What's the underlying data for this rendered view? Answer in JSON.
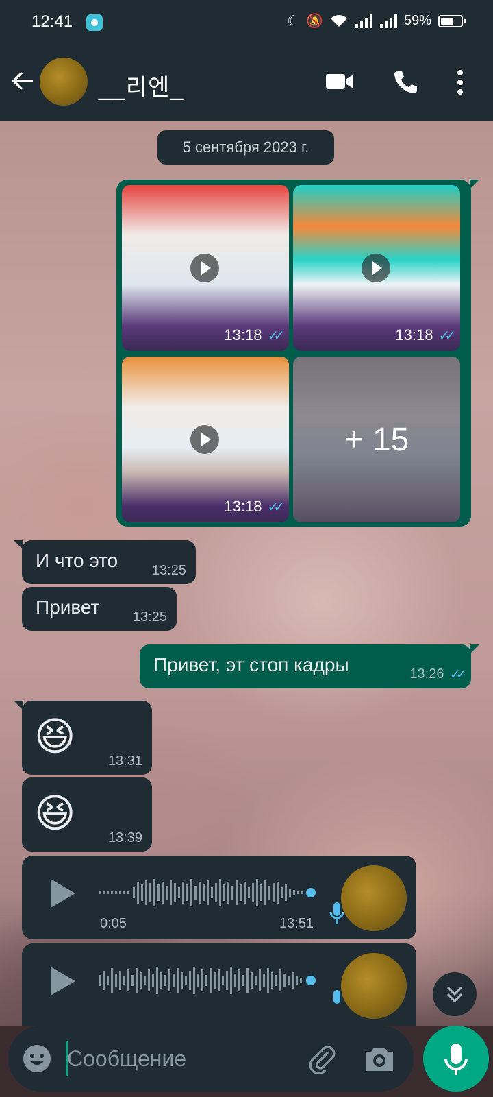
{
  "status_bar": {
    "time": "12:41",
    "battery": "59%"
  },
  "header": {
    "contact_name": "__리엔_"
  },
  "chat": {
    "date_chip": "5 сентября 2023 г.",
    "media_group": {
      "tiles": [
        {
          "time": "13:18"
        },
        {
          "time": "13:18"
        },
        {
          "time": "13:18"
        }
      ],
      "more_count": "+ 15"
    },
    "messages": [
      {
        "text": "И что это",
        "time": "13:25"
      },
      {
        "text": "Привет",
        "time": "13:25"
      },
      {
        "text": "Привет, эт стоп кадры",
        "time": "13:26"
      },
      {
        "text": "😆",
        "time": "13:31"
      },
      {
        "text": "😆",
        "time": "13:39"
      }
    ],
    "voice_messages": [
      {
        "duration": "0:05",
        "time": "13:51"
      },
      {
        "duration": "",
        "time": ""
      }
    ]
  },
  "input": {
    "placeholder": "Сообщение"
  },
  "colors": {
    "accent": "#00a884",
    "bubble_out": "#005c4b",
    "bubble_in": "#1f2c34",
    "read_ticks": "#53bdeb"
  },
  "icons": [
    "back-arrow-icon",
    "video-call-icon",
    "phone-icon",
    "more-vert-icon",
    "play-icon",
    "emoji-icon",
    "attach-icon",
    "camera-icon",
    "mic-icon",
    "chevron-down-icon"
  ]
}
